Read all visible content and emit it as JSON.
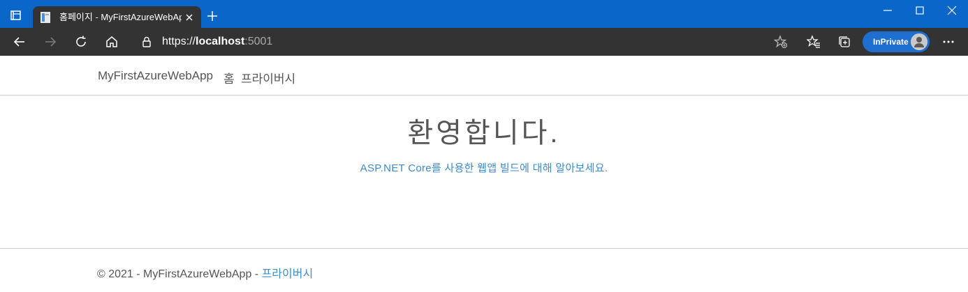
{
  "browser": {
    "tab": {
      "title": "홈페이지 - MyFirstAzureWebApp"
    },
    "address": {
      "scheme": "https://",
      "host": "localhost",
      "port": ":5001"
    },
    "inprivate_label": "InPrivate",
    "colors": {
      "titlebar": "#0b66c9",
      "toolbar": "#333333",
      "inprivate": "#1f6fd0"
    },
    "icons": [
      "tab-actions-icon",
      "page-favicon-icon",
      "close-icon",
      "new-tab-icon",
      "minimize-icon",
      "maximize-icon",
      "window-close-icon",
      "back-icon",
      "forward-icon",
      "refresh-icon",
      "home-icon",
      "lock-icon",
      "add-favorite-icon",
      "favorites-icon",
      "collections-icon",
      "profile-avatar-icon",
      "more-icon"
    ]
  },
  "nav": {
    "brand": "MyFirstAzureWebApp",
    "home": "홈",
    "privacy": "프라이버시"
  },
  "main": {
    "heading": "환영합니다.",
    "learn_link": "ASP.NET Core를 사용한 웹앱 빌드에 대해 알아보세요."
  },
  "footer": {
    "copyright": "© 2021 - MyFirstAzureWebApp -",
    "privacy": "프라이버시"
  },
  "colors": {
    "link": "#3d8bc9",
    "text": "#555555"
  }
}
